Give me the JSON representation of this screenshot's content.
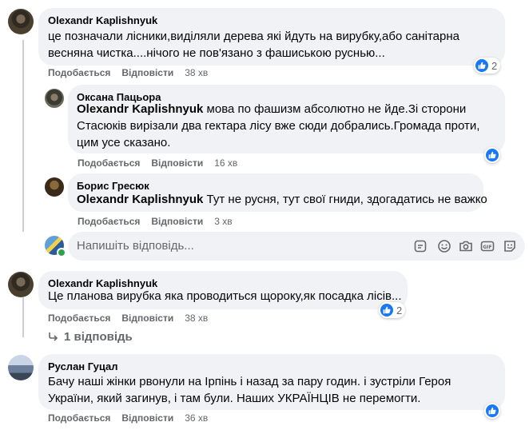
{
  "comments": [
    {
      "author": "Olexandr Kaplishnyuk",
      "text": "це позначали лісники,виділяли дерева які йдуть на вирубку,або санітарна весняна чистка....нічого не пов'язано з фашиською руснью...",
      "like": "Подобається",
      "reply": "Відповісти",
      "time": "38 хв",
      "reactions": "2"
    },
    {
      "author": "Оксана Пацьора",
      "mention": "Olexandr Kaplishnyuk",
      "text": " мова по фашизм абсолютно не йде.Зі сторони Стасюків вирізали два гектара лісу вже сюди добрались.Громада проти, цим усе сказано.",
      "like": "Подобається",
      "reply": "Відповісти",
      "time": "16 хв"
    },
    {
      "author": "Борис Гресюк",
      "mention": "Olexandr Kaplishnyuk",
      "text": " Тут не русня, тут свої гниди, здогадатись не важко",
      "like": "Подобається",
      "reply": "Відповісти",
      "time": "3 хв"
    },
    {
      "author": "Olexandr Kaplishnyuk",
      "text": "Це планова вирубка яка проводиться щороку,як посадка лісів...",
      "like": "Подобається",
      "reply": "Відповісти",
      "time": "38 хв",
      "reactions": "2"
    },
    {
      "author": "Руслан Гуцал",
      "text": "Бачу наші жінки рвонули на Ірпінь і назад за пару годин. і зустріли Героя України, який загинув, і там були. Наших УКРАЇНЦІВ не перемогти.",
      "like": "Подобається",
      "reply": "Відповісти",
      "time": "36 хв"
    }
  ],
  "reply_box": {
    "placeholder": "Напишіть відповідь..."
  },
  "more_replies": "1 відповідь",
  "colors": {
    "bubble": "#f0f2f5",
    "like_blue": "#1877f2",
    "meta_gray": "#65676b"
  },
  "icons": [
    "thumbs-up-icon",
    "sticker-icon",
    "emoji-icon",
    "camera-icon",
    "gif-icon",
    "avatar-sticker-icon",
    "reply-arrow-icon"
  ]
}
